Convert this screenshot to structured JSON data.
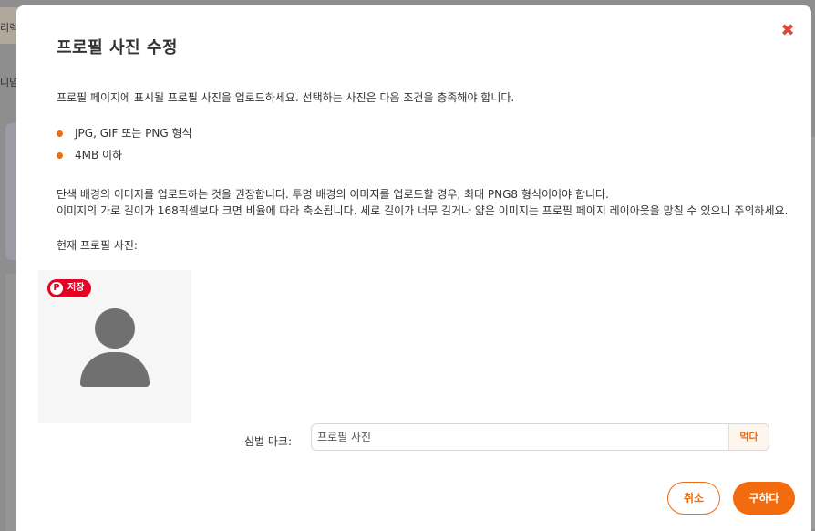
{
  "background": {
    "fragments": [
      "리렉.",
      "니념하",
      "ㅏ"
    ]
  },
  "modal": {
    "title": "프로필 사진 수정",
    "close_icon": "close-x-icon",
    "intro": "프로필 페이지에 표시될 프로필 사진을 업로드하세요. 선택하는 사진은 다음 조건을 충족해야 합니다.",
    "requirements": [
      "JPG, GIF 또는 PNG 형식",
      "4MB 이하"
    ],
    "notice_lines": [
      "단색 배경의 이미지를 업로드하는 것을 권장합니다. 투명 배경의 이미지를 업로드할 경우, 최대 PNG8 형식이어야 합니다.",
      "이미지의 가로 길이가 168픽셀보다 크면 비율에 따라 축소됩니다. 세로 길이가 너무 길거나 얇은 이미지는 프로필 페이지 레이아웃을 망칠 수 있으니 주의하세요."
    ],
    "current_label": "현재 프로필 사진:",
    "pin_badge": {
      "icon": "P",
      "label": "저장"
    },
    "alt": {
      "label": "심벌 마크:",
      "placeholder": "프로필 사진",
      "button": "먹다"
    },
    "buttons": {
      "cancel": "취소",
      "submit": "구하다"
    },
    "colors": {
      "accent": "#f26b0f",
      "close": "#e0453a",
      "pinterest": "#e60023"
    }
  }
}
